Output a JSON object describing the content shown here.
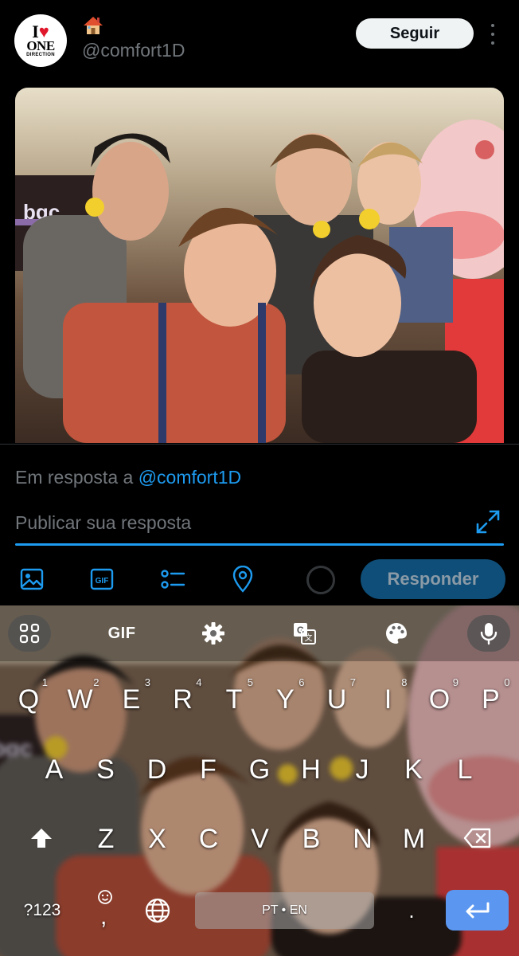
{
  "tweet": {
    "handle": "@comfort1D",
    "follow_label": "Seguir",
    "avatar_text": {
      "line1_a": "I",
      "line1_b": "♥",
      "line2": "ONE",
      "line3": "DIRECTION"
    }
  },
  "reply": {
    "prefix": "Em resposta a ",
    "mention": "@comfort1D",
    "placeholder": "Publicar sua resposta",
    "button_label": "Responder"
  },
  "keyboard": {
    "toolbar": {
      "gif_label": "GIF"
    },
    "rows": [
      [
        {
          "k": "Q",
          "n": "1"
        },
        {
          "k": "W",
          "n": "2"
        },
        {
          "k": "E",
          "n": "3"
        },
        {
          "k": "R",
          "n": "4"
        },
        {
          "k": "T",
          "n": "5"
        },
        {
          "k": "Y",
          "n": "6"
        },
        {
          "k": "U",
          "n": "7"
        },
        {
          "k": "I",
          "n": "8"
        },
        {
          "k": "O",
          "n": "9"
        },
        {
          "k": "P",
          "n": "0"
        }
      ],
      [
        {
          "k": "A"
        },
        {
          "k": "S"
        },
        {
          "k": "D"
        },
        {
          "k": "F"
        },
        {
          "k": "G"
        },
        {
          "k": "H"
        },
        {
          "k": "J"
        },
        {
          "k": "K"
        },
        {
          "k": "L"
        }
      ],
      [
        {
          "k": "Z"
        },
        {
          "k": "X"
        },
        {
          "k": "C"
        },
        {
          "k": "V"
        },
        {
          "k": "B"
        },
        {
          "k": "N"
        },
        {
          "k": "M"
        }
      ]
    ],
    "symbols_label": "?123",
    "emoji_comma_label": ",",
    "space_label": "PT • EN",
    "period_label": "."
  },
  "icons": {
    "avatar": "one-direction-logo",
    "badge": "house-emoji",
    "more": "more-vertical-icon",
    "expand": "expand-icon",
    "image": "image-icon",
    "gif": "gif-icon",
    "poll": "poll-icon",
    "location": "location-pin-icon",
    "counter": "character-counter-ring",
    "apps": "grid-apps-icon",
    "settings": "gear-icon",
    "translate": "translate-icon",
    "palette": "palette-icon",
    "mic": "microphone-icon",
    "shift": "shift-arrow-icon",
    "backspace": "backspace-icon",
    "globe": "globe-icon",
    "enter": "enter-arrow-icon"
  },
  "colors": {
    "background": "#000000",
    "accent": "#1d9bf0",
    "muted_text": "#71767b",
    "reply_button_disabled": "#0f4e78",
    "enter_key": "#5b97f0"
  }
}
